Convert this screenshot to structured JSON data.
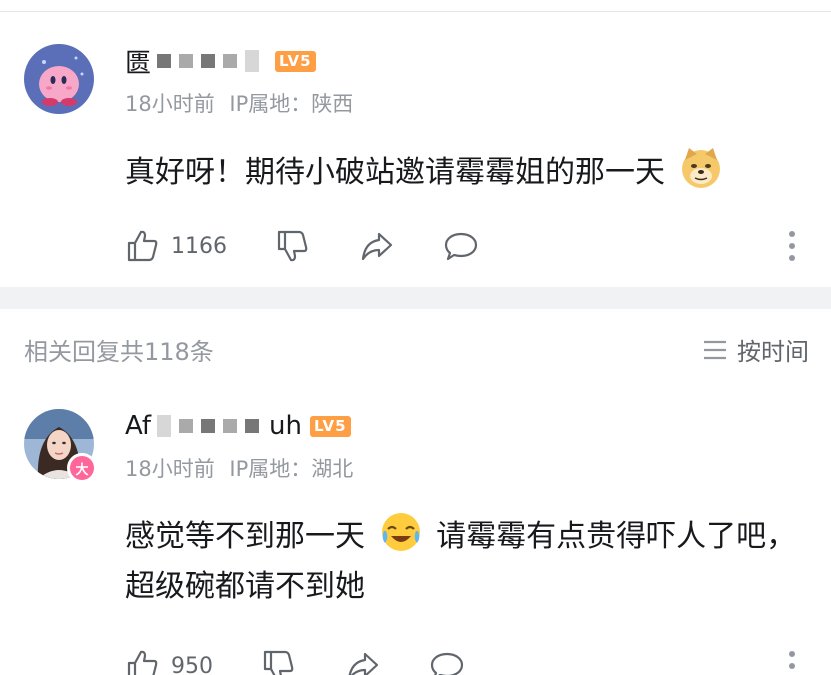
{
  "comment1": {
    "username": "匮",
    "level": "LV5",
    "time": "18小时前",
    "ip": "IP属地：陕西",
    "text": "真好呀！期待小破站邀请霉霉姐的那一天",
    "emoji": "doge-emoji",
    "likes": "1166"
  },
  "replies": {
    "count_label": "相关回复共118条",
    "sort_label": "按时间"
  },
  "comment2": {
    "username_start": "Af",
    "username_end": "uh",
    "level": "LV5",
    "badge": "大",
    "time": "18小时前",
    "ip": "IP属地：湖北",
    "text_part1": "感觉等不到那一天",
    "emoji": "crying-laugh-emoji",
    "text_part2": "请霉霉有点贵得吓人了吧，超级碗都请不到她",
    "likes": "950"
  },
  "colors": {
    "level_badge": "#ff9f45",
    "vip_badge": "#ff6699",
    "secondary_text": "#9499a0",
    "divider": "#f1f2f3"
  },
  "icons": [
    "thumb-up-icon",
    "thumb-down-icon",
    "share-icon",
    "comment-bubble-icon",
    "more-vertical-icon",
    "sort-lines-icon"
  ]
}
